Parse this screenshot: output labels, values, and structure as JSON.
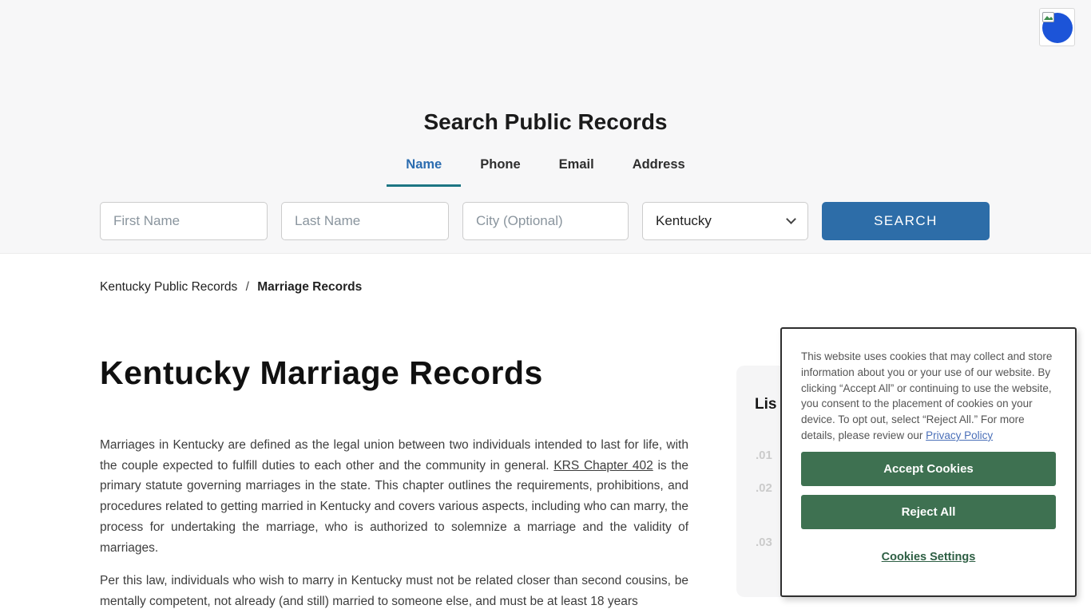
{
  "colors": {
    "primary-blue": "#2d6da8",
    "tab-active": "#2b6cb0",
    "tab-underline": "#1d7684",
    "cookie-green": "#3e7151",
    "settings-green": "#2e5f44",
    "link-blue": "#4a6fb8",
    "widget-blue": "#1c54d8"
  },
  "search": {
    "title": "Search Public Records",
    "tabs": [
      {
        "label": "Name",
        "active": true
      },
      {
        "label": "Phone",
        "active": false
      },
      {
        "label": "Email",
        "active": false
      },
      {
        "label": "Address",
        "active": false
      }
    ],
    "first_name_placeholder": "First Name",
    "last_name_placeholder": "Last Name",
    "city_placeholder": "City (Optional)",
    "state_selected": "Kentucky",
    "search_label": "SEARCH"
  },
  "breadcrumb": {
    "parent": "Kentucky Public Records",
    "separator": "/",
    "current": "Marriage Records"
  },
  "article": {
    "heading": "Kentucky Marriage Records",
    "p1_before": "Marriages in Kentucky are defined as the legal union between two individuals intended to last for life, with the couple expected to fulfill duties to each other and the community in general. ",
    "p1_link": "KRS Chapter 402",
    "p1_after": " is the primary statute governing marriages in the state. This chapter outlines the requirements, prohibitions, and procedures related to getting married in Kentucky and covers various aspects, including who can marry, the process for undertaking the marriage, who is authorized to solemnize a marriage and the validity of marriages.",
    "p2": "Per this law, individuals who wish to marry in Kentucky must not be related closer than second cousins, be mentally competent, not already (and still) married to someone else, and must be at least 18 years"
  },
  "contents_card": {
    "heading_visible": "Lis",
    "items": [
      ".01",
      ".02",
      ".03"
    ]
  },
  "cookie_banner": {
    "message_before": "This website uses cookies that may collect and store information about you or your use of our website. By clicking “Accept All” or continuing to use the website, you consent to the placement of cookies on your device. To opt out, select “Reject All.” For more details, please review our ",
    "privacy_link": "Privacy Policy",
    "accept_label": "Accept Cookies",
    "reject_label": "Reject All",
    "settings_label": "Cookies Settings"
  }
}
